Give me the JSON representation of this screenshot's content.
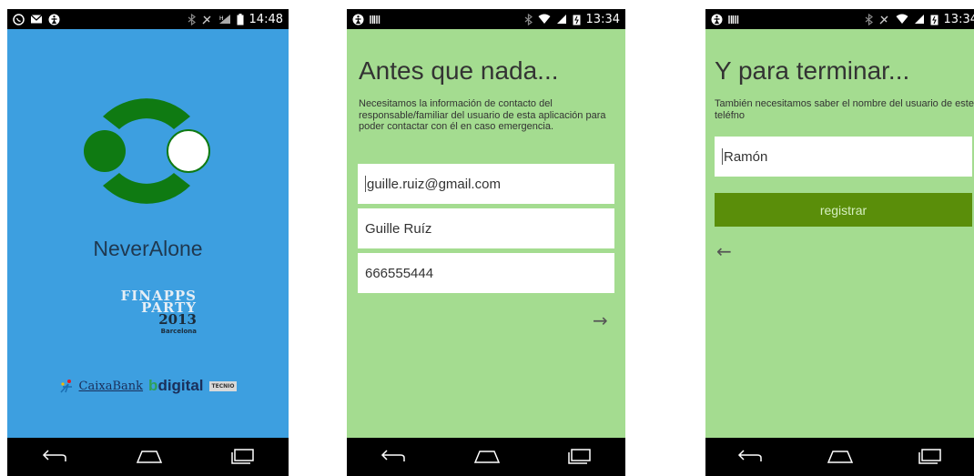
{
  "screens": [
    {
      "status": {
        "time": "14:48"
      },
      "app_name": "NeverAlone",
      "event": {
        "line1": "FINAPPS",
        "line2": "PARTY",
        "year": "2013",
        "city": "Barcelona"
      },
      "sponsors": {
        "caixa": "CaixaBank",
        "bdigital_b": "b",
        "bdigital_rest": "digital",
        "tecnio": "TECNIO"
      }
    },
    {
      "status": {
        "time": "13:34"
      },
      "title": "Antes que nada...",
      "description": "Necesitamos la información de contacto del responsable/familiar del usuario de esta aplicación para poder contactar con él en caso emergencia.",
      "fields": {
        "email": "guille.ruiz@gmail.com",
        "name": "Guille Ruíz",
        "phone": "666555444"
      }
    },
    {
      "status": {
        "time": "13:34"
      },
      "title": "Y para terminar...",
      "description": "También necesitamos saber el nombre del usuario de este teléfno",
      "fields": {
        "user_name": "Ramón"
      },
      "register_label": "registrar"
    }
  ],
  "colors": {
    "splash_bg": "#3d9fe0",
    "form_bg": "#a4dc90",
    "button": "#5a8e0a",
    "logo_green": "#0f7a12"
  }
}
